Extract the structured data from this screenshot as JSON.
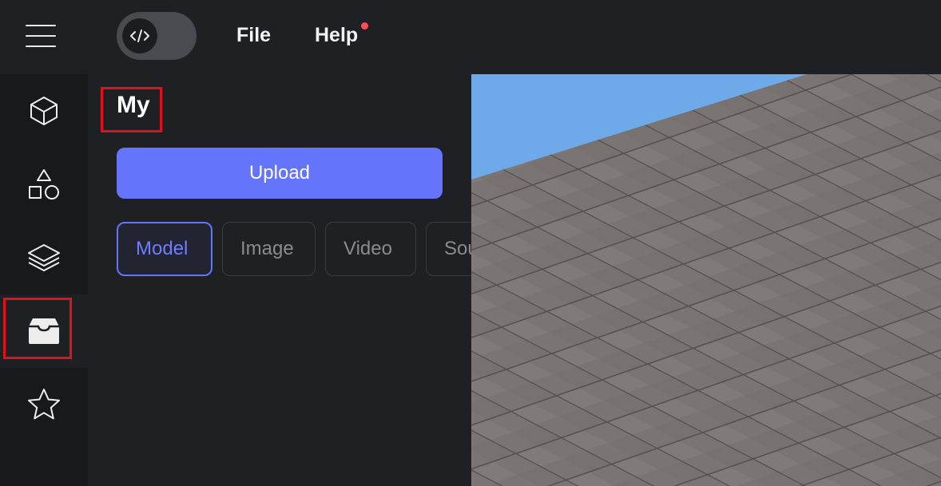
{
  "topbar": {
    "menu_icon": "hamburger-menu-icon",
    "toggle_icon": "code-icon",
    "file_label": "File",
    "help_label": "Help",
    "help_notification": true
  },
  "siderail": {
    "items": [
      {
        "icon": "cube-icon"
      },
      {
        "icon": "shapes-icon"
      },
      {
        "icon": "layers-icon"
      },
      {
        "icon": "inbox-icon",
        "active": true
      },
      {
        "icon": "star-icon"
      }
    ]
  },
  "panel": {
    "title": "My",
    "upload_label": "Upload",
    "tabs": [
      {
        "label": "Model",
        "active": true
      },
      {
        "label": "Image"
      },
      {
        "label": "Video"
      },
      {
        "label": "Sound"
      }
    ]
  },
  "viewport": {
    "sky_color": "#6ea9ea",
    "ground_color": "#7a7573"
  },
  "colors": {
    "accent": "#6474fb",
    "highlight": "#e0101c",
    "notification": "#ff4d5a"
  }
}
